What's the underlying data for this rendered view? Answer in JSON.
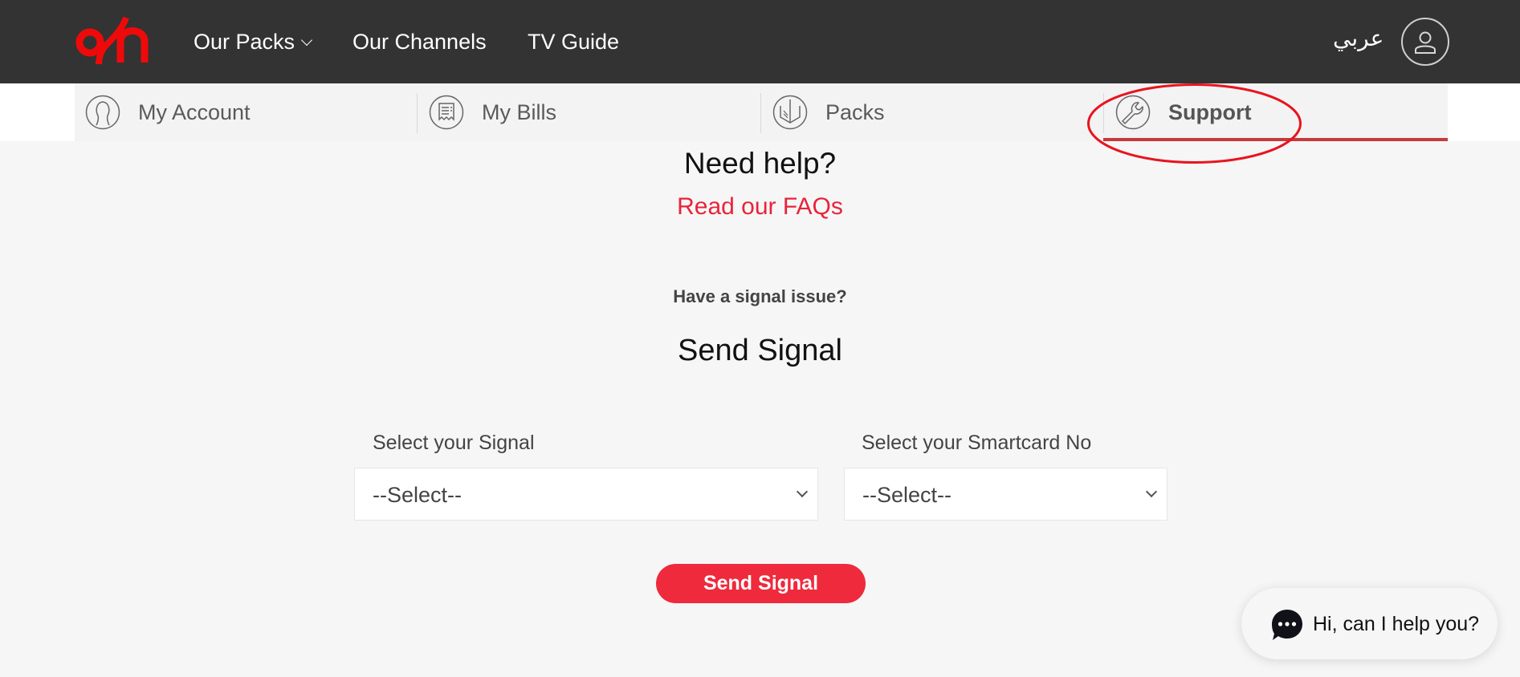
{
  "header": {
    "logo_alt": "osn",
    "nav": [
      {
        "label": "Our Packs",
        "has_dropdown": true
      },
      {
        "label": "Our Channels"
      },
      {
        "label": "TV Guide"
      }
    ],
    "language_toggle": "عربي",
    "account_icon": "user-icon"
  },
  "subnav": {
    "tabs": [
      {
        "label": "My Account",
        "icon": "user-silhouette-icon",
        "active": false
      },
      {
        "label": "My Bills",
        "icon": "receipt-icon",
        "active": false
      },
      {
        "label": "Packs",
        "icon": "pack-box-icon",
        "active": false
      },
      {
        "label": "Support",
        "icon": "wrench-icon",
        "active": true
      }
    ]
  },
  "main": {
    "heading": "Need help?",
    "faq_link": "Read our FAQs",
    "signal_question": "Have a signal issue?",
    "section_title": "Send Signal",
    "fields": [
      {
        "label": "Select your Signal",
        "value": "--Select--"
      },
      {
        "label": "Select your Smartcard No",
        "value": "--Select--"
      }
    ],
    "submit_label": "Send Signal"
  },
  "chat_widget": {
    "text": "Hi, can I help you?",
    "icon": "chat-bubble-icon"
  },
  "colors": {
    "header_bg": "#333333",
    "brand_red": "#ee2a3c",
    "link_red": "#e8243a",
    "active_underline": "#c8383c",
    "annotation_red": "#e8141e"
  }
}
